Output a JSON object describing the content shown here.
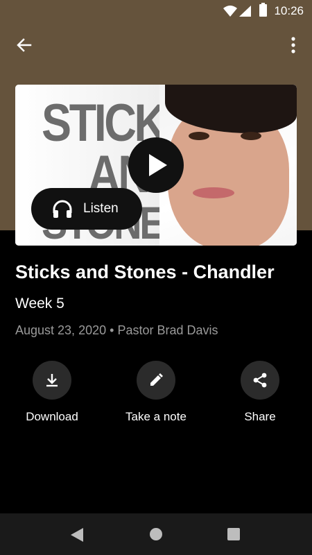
{
  "status_bar": {
    "time": "10:26"
  },
  "episode": {
    "artwork_words": [
      "STICKS",
      "AND",
      "STONES"
    ],
    "listen_label": "Listen",
    "title": "Sticks and Stones - Chandler",
    "subtitle": "Week 5",
    "date": "August 23, 2020",
    "separator": "•",
    "speaker": "Pastor Brad Davis"
  },
  "actions": {
    "download": "Download",
    "note": "Take a note",
    "share": "Share"
  },
  "colors": {
    "header": "#65533c",
    "background": "#000000",
    "action_circle": "#2b2b2b",
    "meta_text": "#9a9a9a"
  },
  "icons": [
    "arrow-back-icon",
    "more-vert-icon",
    "play-icon",
    "headphones-icon",
    "download-icon",
    "pencil-icon",
    "share-icon",
    "nav-back-icon",
    "nav-home-icon",
    "nav-recents-icon"
  ]
}
